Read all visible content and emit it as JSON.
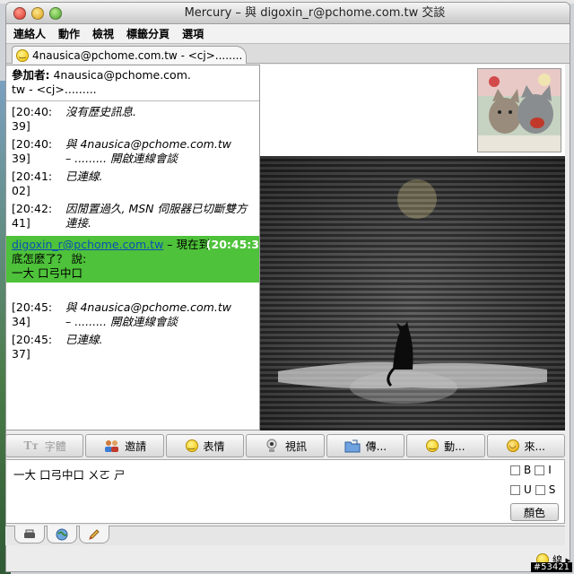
{
  "window": {
    "title": "Mercury – 與 digoxin_r@pchome.com.tw 交談"
  },
  "menu": [
    "連絡人",
    "動作",
    "檢視",
    "標籤分頁",
    "選項"
  ],
  "tab": {
    "label": "4nausica@pchome.com.tw - <cj>........"
  },
  "participants": {
    "label": "參加者:",
    "line1": "4nausica@pchome.com.",
    "line2": "tw - <cj>........."
  },
  "messages": [
    {
      "ts1": "[20:40:",
      "ts2": "39]",
      "line1": "沒有歷史訊息.",
      "line2": ""
    },
    {
      "ts1": "[20:40:",
      "ts2": "39]",
      "line1": "與 4nausica@pchome.com.tw",
      "line2": "– ......... 開啟連線會談"
    },
    {
      "ts1": "[20:41:",
      "ts2": "02]",
      "line1": "已連線.",
      "line2": ""
    },
    {
      "ts1": "[20:42:",
      "ts2": "41]",
      "line1": "因閒置過久, MSN 伺服器已切斷雙方",
      "line2": "連接."
    }
  ],
  "highlight": {
    "sender": "digoxin_r@pchome.com.tw",
    "rest": " – 現在到",
    "ts": "(20:45:3",
    "line2": "底怎麼了？ 說:",
    "line3": "一大 口弓中口"
  },
  "messages2": [
    {
      "ts1": "[20:45:",
      "ts2": "34]",
      "line1": "與 4nausica@pchome.com.tw",
      "line2": "– ......... 開啟連線會談"
    },
    {
      "ts1": "[20:45:",
      "ts2": "37]",
      "line1": "已連線.",
      "line2": ""
    }
  ],
  "toolbar": [
    {
      "label": "字體",
      "icon": "font-icon",
      "disabled": true
    },
    {
      "label": "邀請",
      "icon": "invite-icon",
      "disabled": false
    },
    {
      "label": "表情",
      "icon": "emoticon-icon",
      "disabled": false
    },
    {
      "label": "視訊",
      "icon": "webcam-icon",
      "disabled": false
    },
    {
      "label": "傳...",
      "icon": "send-file-icon",
      "disabled": false
    },
    {
      "label": "動...",
      "icon": "action-icon",
      "disabled": false
    },
    {
      "label": "來...",
      "icon": "nudge-icon",
      "disabled": false
    }
  ],
  "compose": {
    "text": "一大 口弓中口 ㄨㄛ ㄕ"
  },
  "format": {
    "bold": "B",
    "italic": "I",
    "underline": "U",
    "strike": "S",
    "color": "顏色"
  },
  "status": {
    "text": "線 ▸"
  },
  "watermark": "#53421",
  "colors": {
    "highlight": "#4ec23a",
    "link": "#0b4fb5"
  }
}
